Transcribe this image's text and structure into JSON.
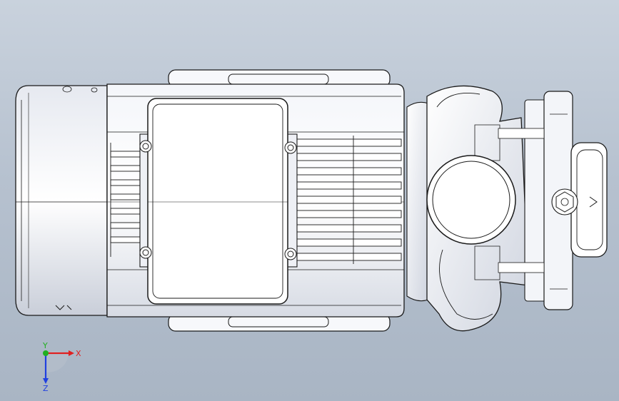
{
  "viewport": {
    "background_top": "#c9d2dd",
    "background_bottom": "#a9b5c4",
    "model_fill": "#ffffff",
    "model_stroke": "#1a1a1a"
  },
  "triad": {
    "x_label": "X",
    "y_label": "Y",
    "z_label": "Z",
    "x_color": "#e02020",
    "y_color": "#20b020",
    "z_color": "#2040e0"
  }
}
